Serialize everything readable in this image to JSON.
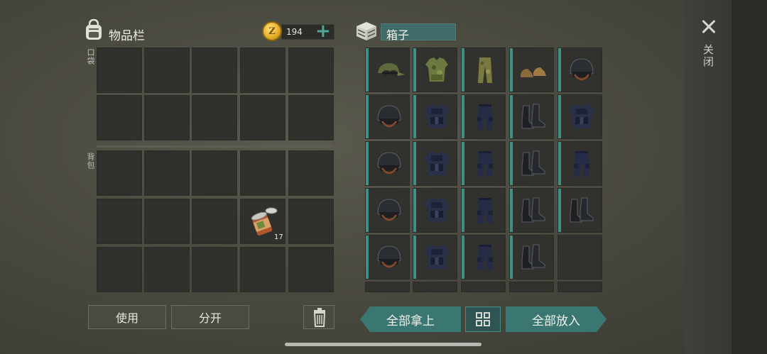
{
  "inventory": {
    "title": "物品栏",
    "coins": "194",
    "pocket_label": "口袋",
    "backpack_label": "背包",
    "can_count": "17"
  },
  "box": {
    "title": "箱子"
  },
  "buttons": {
    "use": "使用",
    "split": "分开",
    "take_all": "全部拿上",
    "put_all": "全部放入"
  },
  "close_label": "关闭",
  "icons": {
    "bag": "backpack-icon",
    "coin": "coin-icon",
    "plus": "plus-icon",
    "box": "box-icon",
    "close": "close-icon",
    "trash": "trash-icon",
    "sort": "sort-grid-icon"
  },
  "box_items": [
    [
      "camo-cap",
      "camo-vest",
      "camo-pants",
      "leather-shoes",
      "police-helmet"
    ],
    [
      "police-helmet",
      "police-vest",
      "police-pants",
      "police-boots",
      "police-vest"
    ],
    [
      "police-helmet",
      "police-vest",
      "police-pants",
      "police-boots",
      "police-pants"
    ],
    [
      "police-helmet",
      "police-vest",
      "police-pants",
      "police-boots",
      "police-boots"
    ],
    [
      "police-helmet",
      "police-vest",
      "police-pants",
      "police-boots",
      ""
    ]
  ],
  "colors": {
    "accent": "#3e8f86",
    "button_teal": "#3a7772"
  }
}
